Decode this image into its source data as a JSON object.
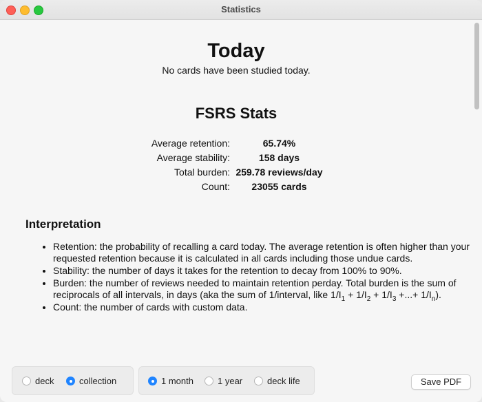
{
  "window": {
    "title": "Statistics"
  },
  "today": {
    "heading": "Today",
    "message": "No cards have been studied today."
  },
  "fsrs": {
    "heading": "FSRS Stats",
    "rows": [
      {
        "label": "Average retention:",
        "value": "65.74%"
      },
      {
        "label": "Average stability:",
        "value": "158 days"
      },
      {
        "label": "Total burden:",
        "value": "259.78 reviews/day"
      },
      {
        "label": "Count:",
        "value": "23055 cards"
      }
    ]
  },
  "interpretation": {
    "heading": "Interpretation",
    "items": [
      "Retention: the probability of recalling a card today. The average retention is often higher than your requested retention because it is calculated in all cards including those undue cards.",
      "Stability: the number of days it takes for the retention to decay from 100% to 90%.",
      "Burden: the number of reviews needed to maintain retention perday. Total burden is the sum of reciprocals of all intervals, in days (aka the sum of 1/interval, like 1/I",
      "Count: the number of cards with custom data."
    ],
    "burden_formula": {
      "part1": " + 1/I",
      "part2": " + 1/I",
      "part3": " +...+ 1/I",
      "end": ").",
      "sub1": "1",
      "sub2": "2",
      "sub3": "3",
      "subn": "n"
    }
  },
  "scope": {
    "options": [
      {
        "label": "deck",
        "selected": false
      },
      {
        "label": "collection",
        "selected": true
      }
    ]
  },
  "range": {
    "options": [
      {
        "label": "1 month",
        "selected": true
      },
      {
        "label": "1 year",
        "selected": false
      },
      {
        "label": "deck life",
        "selected": false
      }
    ]
  },
  "actions": {
    "save_pdf": "Save PDF"
  }
}
